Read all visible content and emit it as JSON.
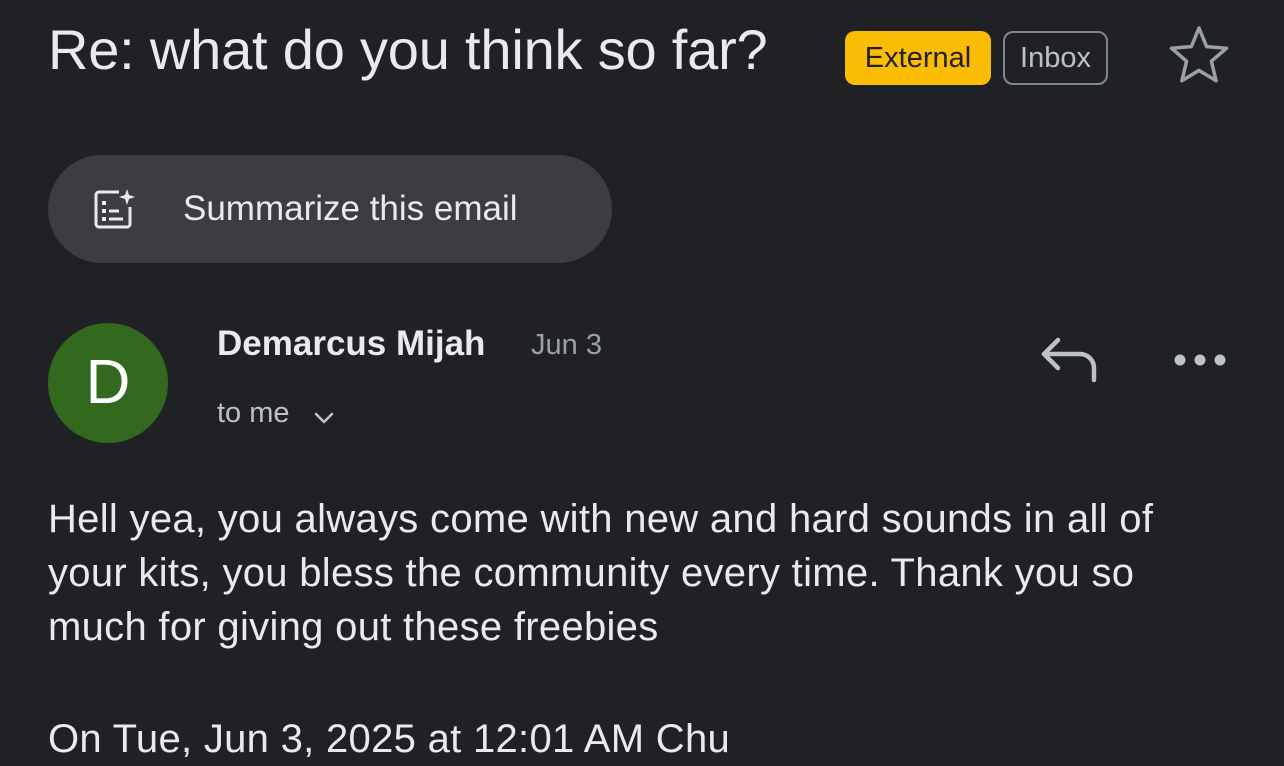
{
  "header": {
    "subject": "Re: what do you think so far?",
    "labels": [
      "External",
      "Inbox"
    ],
    "star_icon": "star-outline-icon"
  },
  "summarize": {
    "label": "Summarize this email",
    "icon": "summarize-sparkle-icon"
  },
  "message": {
    "avatar_initial": "D",
    "avatar_color": "#33691e",
    "sender": "Demarcus Mijah",
    "date": "Jun 3",
    "recipient": "to me",
    "body": "Hell yea, you always come with new and hard sounds in all of your kits, you bless the community every time. Thank you so much for giving out these freebies",
    "quote_header": "On Tue, Jun 3, 2025 at 12:01 AM Chu"
  },
  "colors": {
    "background": "#202124",
    "external_badge": "#fbbc04",
    "summarize_bg": "#3c3d40"
  }
}
